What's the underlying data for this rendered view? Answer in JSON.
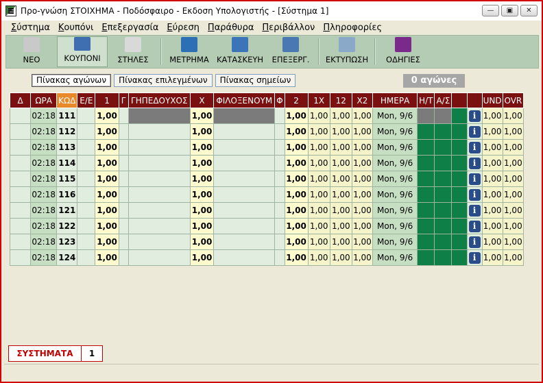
{
  "window": {
    "title": "Προ-γνώση ΣΤΟΙΧΗΜΑ - Ποδόσφαιρο - Εκδοση Υπολογιστής - [Σύστημα 1]",
    "controls": {
      "minimize": "—",
      "restore": "▣",
      "close": "✕"
    }
  },
  "menu": [
    {
      "first": "Σ",
      "rest": "ύστημα"
    },
    {
      "first": "Κ",
      "rest": "ουπόνι"
    },
    {
      "first": "Ε",
      "rest": "πεξεργασία"
    },
    {
      "first": "Ε",
      "rest": "ύρεση"
    },
    {
      "first": "Π",
      "rest": "αράθυρα"
    },
    {
      "first": "Π",
      "rest": "εριβάλλον"
    },
    {
      "first": "Π",
      "rest": "ληροφορίες"
    }
  ],
  "toolbar": [
    {
      "label": "ΝΕΟ",
      "icon": "new-document-icon",
      "color": "#c9c9c9"
    },
    {
      "label": "ΚΟΥΠΟΝΙ",
      "icon": "coupon-icon",
      "color": "#3f6fb0"
    },
    {
      "label": "ΣΤΗΛΕΣ",
      "icon": "columns-icon",
      "color": "#d9d9d9"
    },
    {
      "label": "ΜΕΤΡΗΜΑ",
      "icon": "count-icon",
      "color": "#2d6fb5"
    },
    {
      "label": "ΚΑΤΑΣΚΕΥΗ",
      "icon": "gears-icon",
      "color": "#3b74b8"
    },
    {
      "label": "ΕΠΕΞΕΡΓ.",
      "icon": "edit-icon",
      "color": "#4a78b3"
    },
    {
      "label": "ΕΚΤΥΠΩΣΗ",
      "icon": "printer-icon",
      "color": "#8aa8c8"
    },
    {
      "label": "ΟΔΗΓΙΕΣ",
      "icon": "help-book-icon",
      "color": "#7a2a8a"
    }
  ],
  "tabs": {
    "matches": "Πίνακας αγώνων",
    "selected": "Πίνακας επιλεγμένων",
    "signs": "Πίνακας σημείων"
  },
  "match_count": "0 αγώνες",
  "columns": {
    "d": "Δ",
    "time": "ΩΡΑ",
    "code": "ΚΩΔ",
    "ee": "Ε/Ε",
    "one": "1",
    "g": "Γ",
    "home": "ΓΗΠΕΔΟΥΧΟΣ",
    "x": "Χ",
    "away": "ΦΙΛΟΞΕΝΟΥΜ",
    "f": "Φ",
    "two": "2",
    "onex": "1Χ",
    "onetwo": "12",
    "x2": "Χ2",
    "day": "ΗΜΕΡΑ",
    "ht": "Η/Τ",
    "as": "Α/Σ",
    "und": "UND",
    "ovr": "OVR"
  },
  "rows": [
    {
      "time": "02:18",
      "code": "111",
      "one": "1,00",
      "x": "1,00",
      "two": "1,00",
      "onex": "1,00",
      "onetwo": "1,00",
      "x2": "1,00",
      "day": "Mon, 9/6",
      "und": "1,00",
      "ovr": "1,00"
    },
    {
      "time": "02:18",
      "code": "112",
      "one": "1,00",
      "x": "1,00",
      "two": "1,00",
      "onex": "1,00",
      "onetwo": "1,00",
      "x2": "1,00",
      "day": "Mon, 9/6",
      "und": "1,00",
      "ovr": "1,00"
    },
    {
      "time": "02:18",
      "code": "113",
      "one": "1,00",
      "x": "1,00",
      "two": "1,00",
      "onex": "1,00",
      "onetwo": "1,00",
      "x2": "1,00",
      "day": "Mon, 9/6",
      "und": "1,00",
      "ovr": "1,00"
    },
    {
      "time": "02:18",
      "code": "114",
      "one": "1,00",
      "x": "1,00",
      "two": "1,00",
      "onex": "1,00",
      "onetwo": "1,00",
      "x2": "1,00",
      "day": "Mon, 9/6",
      "und": "1,00",
      "ovr": "1,00"
    },
    {
      "time": "02:18",
      "code": "115",
      "one": "1,00",
      "x": "1,00",
      "two": "1,00",
      "onex": "1,00",
      "onetwo": "1,00",
      "x2": "1,00",
      "day": "Mon, 9/6",
      "und": "1,00",
      "ovr": "1,00"
    },
    {
      "time": "02:18",
      "code": "116",
      "one": "1,00",
      "x": "1,00",
      "two": "1,00",
      "onex": "1,00",
      "onetwo": "1,00",
      "x2": "1,00",
      "day": "Mon, 9/6",
      "und": "1,00",
      "ovr": "1,00"
    },
    {
      "time": "02:18",
      "code": "121",
      "one": "1,00",
      "x": "1,00",
      "two": "1,00",
      "onex": "1,00",
      "onetwo": "1,00",
      "x2": "1,00",
      "day": "Mon, 9/6",
      "und": "1,00",
      "ovr": "1,00"
    },
    {
      "time": "02:18",
      "code": "122",
      "one": "1,00",
      "x": "1,00",
      "two": "1,00",
      "onex": "1,00",
      "onetwo": "1,00",
      "x2": "1,00",
      "day": "Mon, 9/6",
      "und": "1,00",
      "ovr": "1,00"
    },
    {
      "time": "02:18",
      "code": "123",
      "one": "1,00",
      "x": "1,00",
      "two": "1,00",
      "onex": "1,00",
      "onetwo": "1,00",
      "x2": "1,00",
      "day": "Mon, 9/6",
      "und": "1,00",
      "ovr": "1,00"
    },
    {
      "time": "02:18",
      "code": "124",
      "one": "1,00",
      "x": "1,00",
      "two": "1,00",
      "onex": "1,00",
      "onetwo": "1,00",
      "x2": "1,00",
      "day": "Mon, 9/6",
      "und": "1,00",
      "ovr": "1,00"
    }
  ],
  "info_glyph": "i",
  "systems": {
    "label": "ΣΥΣΤΗΜΑΤΑ",
    "value": "1"
  },
  "colors": {
    "header": "#7a1010",
    "header_highlight": "#e88a2a",
    "toolbar": "#b3ccb3",
    "ht_as_fill": "#0e7f47"
  }
}
